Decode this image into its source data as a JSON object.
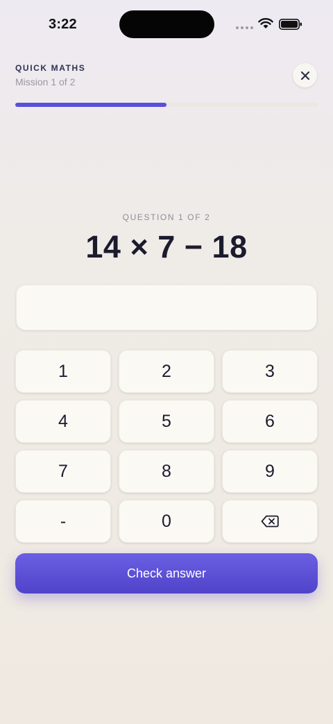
{
  "status_bar": {
    "time": "3:22"
  },
  "header": {
    "app_label": "QUICK MATHS",
    "mission_label": "Mission 1 of 2",
    "close_icon": "close-icon",
    "progress_fraction": 0.5,
    "accent_color": "#5b4fd9"
  },
  "question": {
    "label": "QUESTION 1 OF 2",
    "expression": "14 × 7 − 18"
  },
  "answer": {
    "value": ""
  },
  "keypad": {
    "keys": [
      "1",
      "2",
      "3",
      "4",
      "5",
      "6",
      "7",
      "8",
      "9",
      "-",
      "0"
    ],
    "backspace_icon": "backspace-icon"
  },
  "actions": {
    "check_label": "Check answer"
  }
}
